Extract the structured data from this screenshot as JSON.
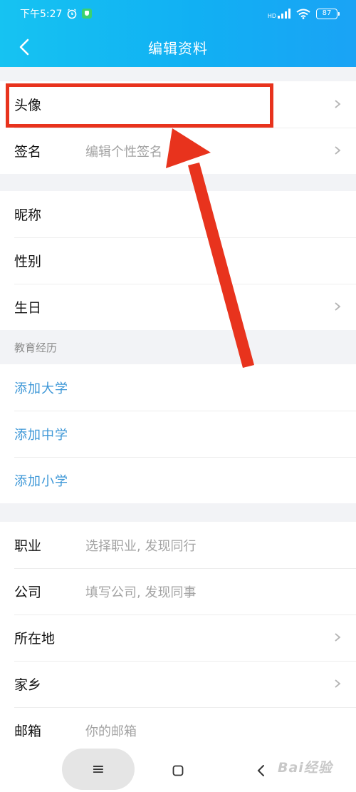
{
  "status_bar": {
    "time": "下午5:27",
    "network": "HD",
    "battery": "87"
  },
  "nav": {
    "title": "编辑资料"
  },
  "basic": {
    "avatar_label": "头像",
    "signature_label": "签名",
    "signature_placeholder": "编辑个性签名"
  },
  "profile": {
    "nickname_label": "昵称",
    "gender_label": "性别",
    "birthday_label": "生日"
  },
  "education": {
    "section_title": "教育经历",
    "add_university": "添加大学",
    "add_middle_school": "添加中学",
    "add_primary_school": "添加小学"
  },
  "work": {
    "occupation_label": "职业",
    "occupation_placeholder": "选择职业, 发现同行",
    "company_label": "公司",
    "company_placeholder": "填写公司, 发现同事",
    "location_label": "所在地",
    "hometown_label": "家乡",
    "email_label": "邮箱",
    "email_placeholder": "你的邮箱"
  },
  "bottom_nav": {
    "menu_glyph": "≡"
  },
  "watermark": {
    "text": "Bai经验"
  },
  "colors": {
    "header": "#11b0f3",
    "annotation": "#e8331d",
    "link": "#3d97d7",
    "placeholder": "#a3a3a3"
  },
  "icons": [
    "clock-icon",
    "shield-icon",
    "signal-icon",
    "wifi-icon",
    "battery-icon",
    "back-arrow-icon",
    "chevron-right-icon",
    "home-icon",
    "menu-icon"
  ]
}
